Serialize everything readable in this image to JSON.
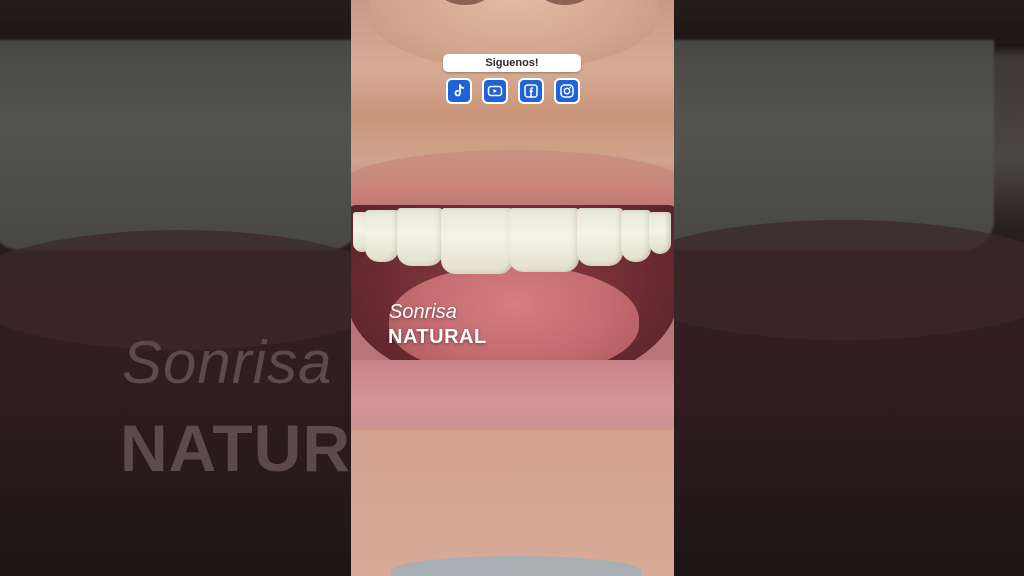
{
  "follow": {
    "label": "Siguenos!",
    "icons": [
      "tiktok-icon",
      "youtube-icon",
      "facebook-icon",
      "instagram-icon"
    ]
  },
  "caption": {
    "line1": "Sonrisa",
    "line2": "NATURAL"
  },
  "colors": {
    "social_button": "#1f63d8",
    "caption_text": "#ffffff"
  }
}
